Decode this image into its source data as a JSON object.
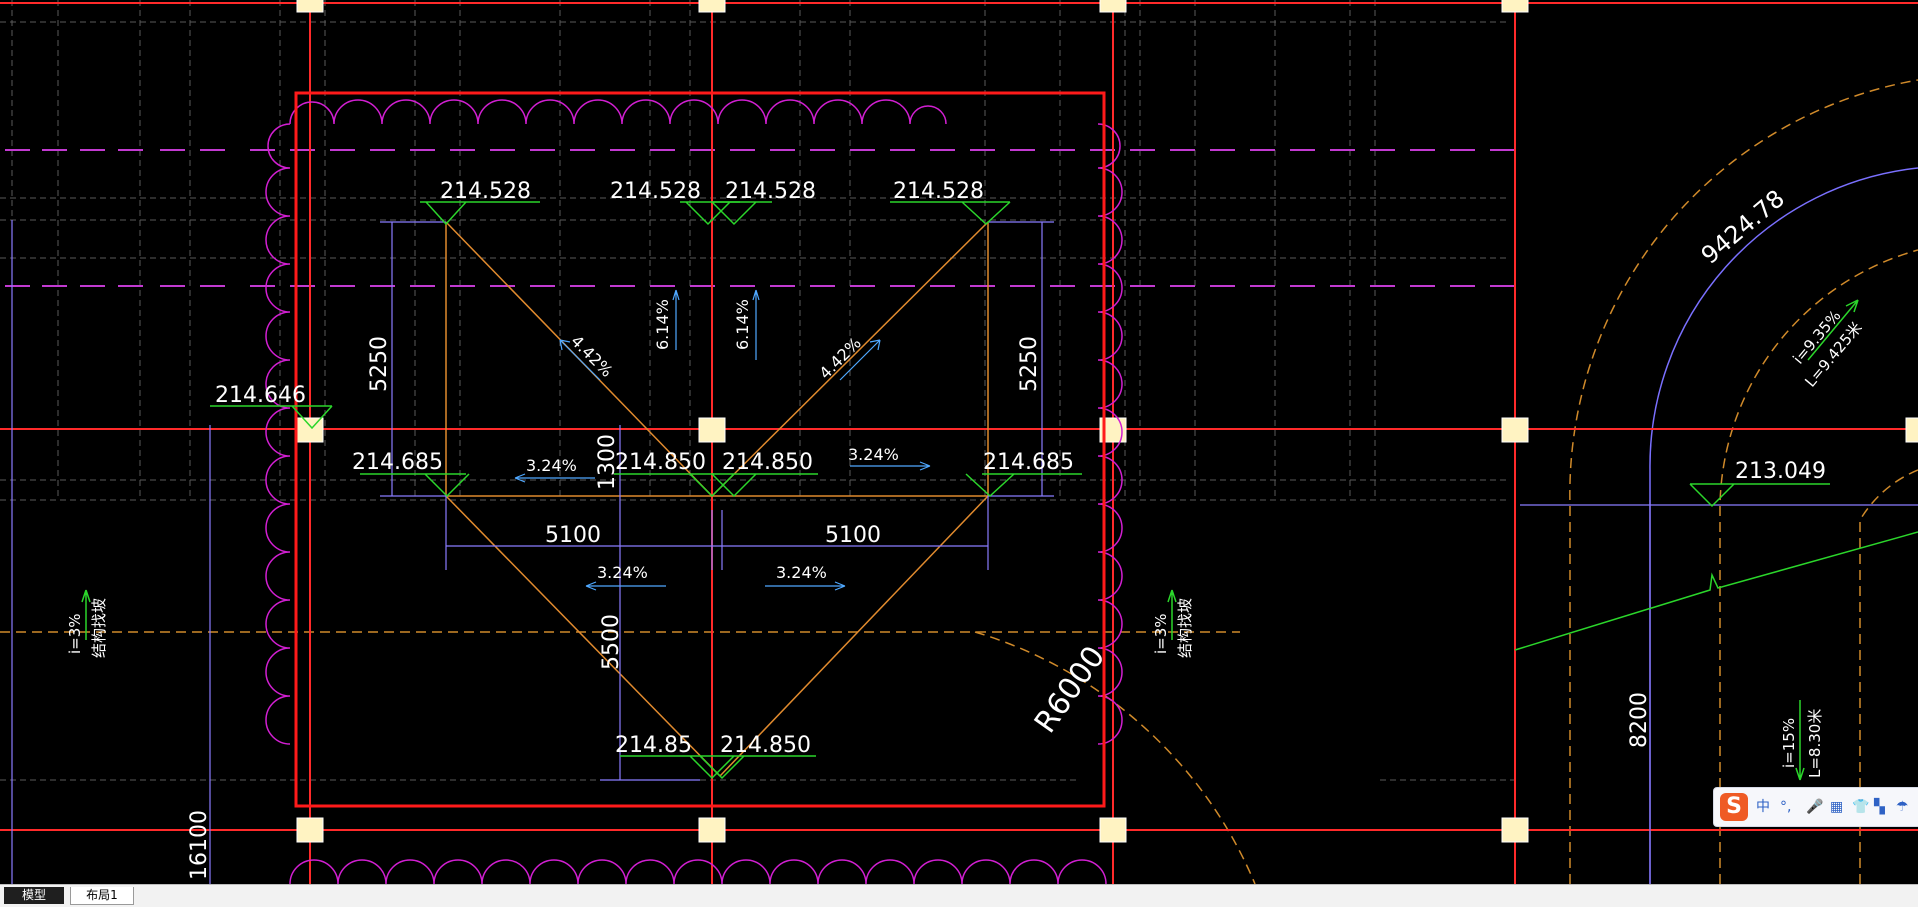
{
  "labels": {
    "e1": "214.528",
    "e2": "214.528",
    "e3": "214.528",
    "e4": "214.528",
    "e5": "214.646",
    "e6": "214.685",
    "e7": "214.850",
    "e8": "214.850",
    "e9": "214.685",
    "e10": "214.85",
    "e11": "214.850",
    "e12": "213.049",
    "d1": "5250",
    "d2": "5250",
    "d3": "1300",
    "d4": "5100",
    "d5": "5100",
    "d6": "5500",
    "d7": "R6000",
    "d8": "9424.78",
    "d9": "8200",
    "d10": "16100",
    "s1": "3.24%",
    "s2": "3.24%",
    "s3": "3.24%",
    "s4": "3.24%",
    "s5": "4.42%",
    "s6": "4.42%",
    "s7": "6.14%",
    "s8": "6.14%",
    "n1": "i=3%",
    "n2": "结构找坡",
    "n3": "i=3%",
    "n4": "结构找坡",
    "n5": "i=9.35%",
    "n6": "L=9.425米",
    "n7": "i=15%",
    "n8": "L=8.30米"
  },
  "tabs": {
    "model": "模型",
    "layout1": "布局1"
  },
  "ime": {
    "logo": "S",
    "mode": "中",
    "punct": "°,",
    "mic": "🎤",
    "keyboard": "▦",
    "skin": "👕",
    "toolbox": "▚",
    "more": "☂"
  },
  "colors": {
    "background": "#000000",
    "grid": "#ff2a2a",
    "revision_cloud": "#d21fd2",
    "slope_line": "#e08a2e",
    "dimension": "#8a7cff",
    "elevation_marker": "#2bd62b",
    "text": "#ffffff"
  }
}
